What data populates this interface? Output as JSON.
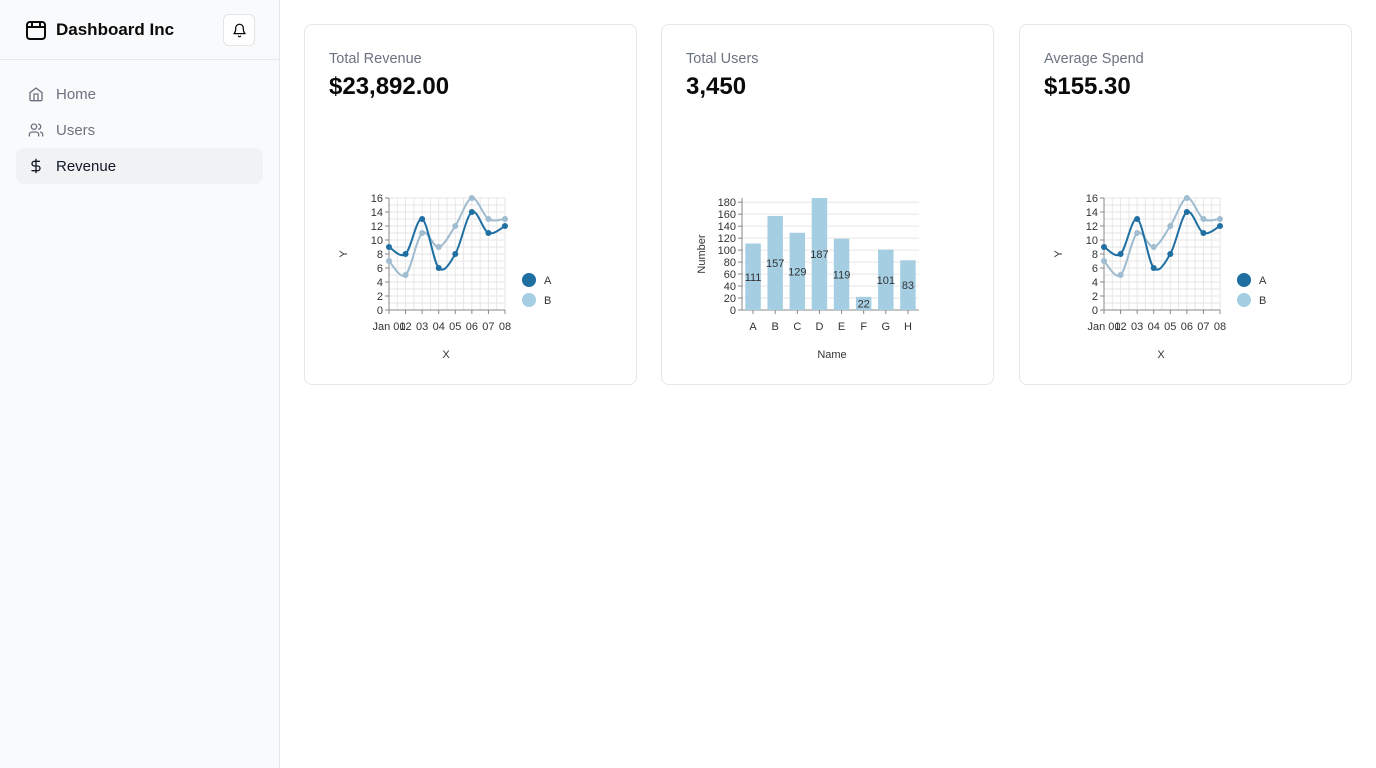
{
  "app": {
    "brand": "Dashboard Inc",
    "brand_icon": "store-icon",
    "bell_icon": "bell-icon"
  },
  "sidebar": {
    "items": [
      {
        "label": "Home",
        "icon": "home-icon",
        "active": false
      },
      {
        "label": "Users",
        "icon": "users-icon",
        "active": false
      },
      {
        "label": "Revenue",
        "icon": "dollar-icon",
        "active": true
      }
    ]
  },
  "cards": [
    {
      "label": "Total Revenue",
      "value": "$23,892.00"
    },
    {
      "label": "Total Users",
      "value": "3,450"
    },
    {
      "label": "Average Spend",
      "value": "$155.30"
    }
  ],
  "colors": {
    "series_a": "#1f6fa3",
    "series_b": "#a6cee3",
    "bar": "#a6cee3"
  },
  "chart_data": [
    {
      "type": "line",
      "x": [
        "Jan 01",
        "02",
        "03",
        "04",
        "05",
        "06",
        "07",
        "08"
      ],
      "xlabel": "X",
      "ylabel": "Y",
      "ylim": [
        0,
        16
      ],
      "yticks": [
        0,
        2,
        4,
        6,
        8,
        10,
        12,
        14,
        16
      ],
      "series": [
        {
          "name": "A",
          "values": [
            9,
            8,
            13,
            6,
            8,
            14,
            11,
            12
          ]
        },
        {
          "name": "B",
          "values": [
            7,
            5,
            11,
            9,
            12,
            16,
            13,
            13
          ]
        }
      ],
      "grid": true,
      "legend": "right"
    },
    {
      "type": "bar",
      "categories": [
        "A",
        "B",
        "C",
        "D",
        "E",
        "F",
        "G",
        "H"
      ],
      "values": [
        111,
        157,
        129,
        187,
        119,
        22,
        101,
        83
      ],
      "xlabel": "Name",
      "ylabel": "Number",
      "ylim": [
        0,
        187
      ],
      "yticks": [
        0,
        20,
        40,
        60,
        80,
        100,
        120,
        140,
        160,
        180
      ],
      "grid": true
    },
    {
      "type": "line",
      "x": [
        "Jan 01",
        "02",
        "03",
        "04",
        "05",
        "06",
        "07",
        "08"
      ],
      "xlabel": "X",
      "ylabel": "Y",
      "ylim": [
        0,
        16
      ],
      "yticks": [
        0,
        2,
        4,
        6,
        8,
        10,
        12,
        14,
        16
      ],
      "series": [
        {
          "name": "A",
          "values": [
            9,
            8,
            13,
            6,
            8,
            14,
            11,
            12
          ]
        },
        {
          "name": "B",
          "values": [
            7,
            5,
            11,
            9,
            12,
            16,
            13,
            13
          ]
        }
      ],
      "grid": true,
      "legend": "right"
    }
  ]
}
